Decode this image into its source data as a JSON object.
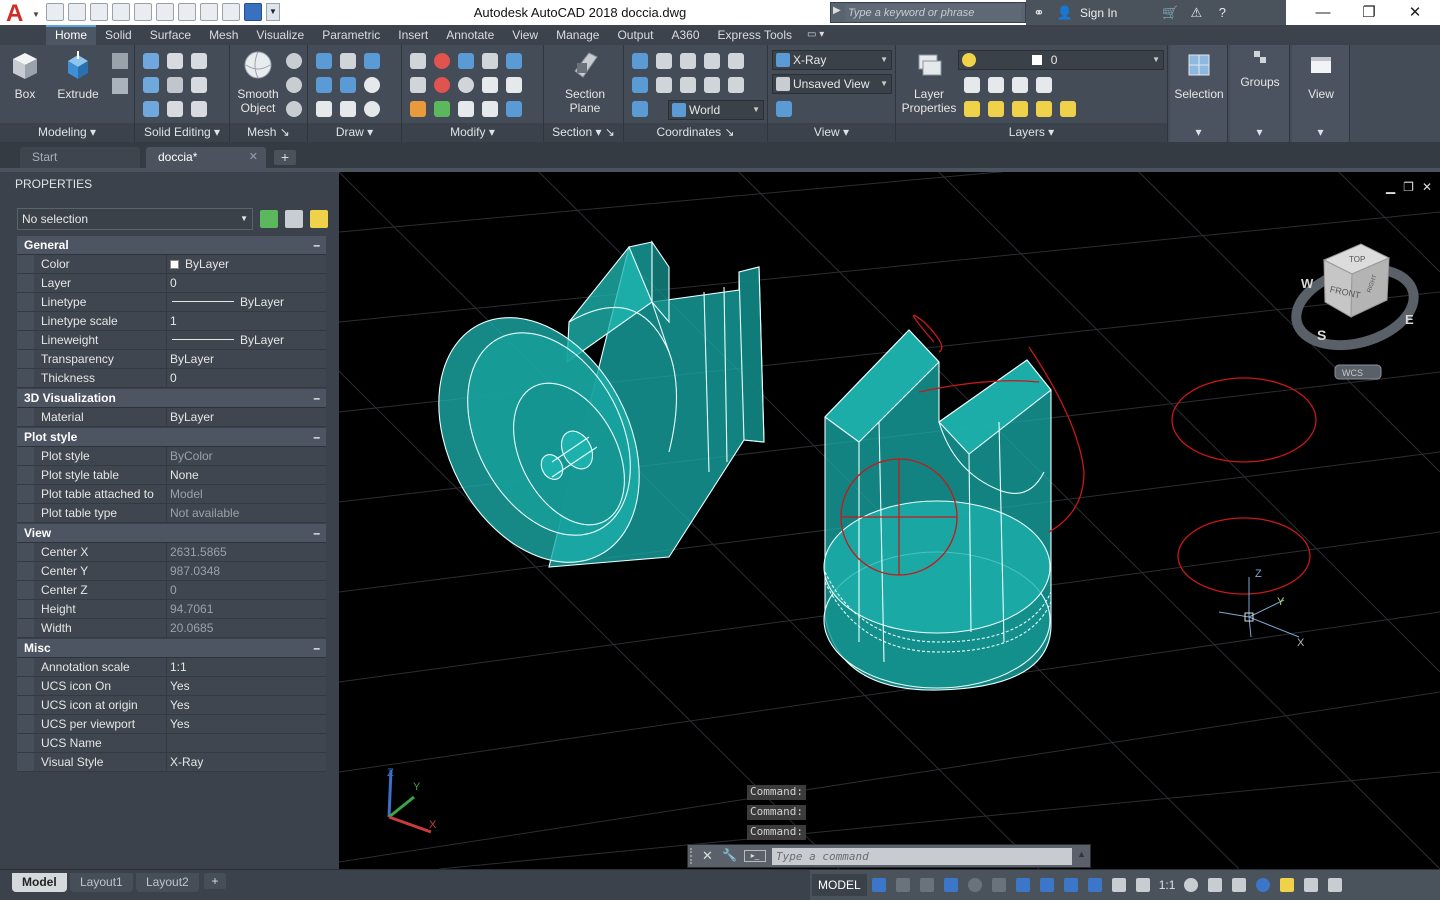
{
  "app": {
    "window_title": "Autodesk AutoCAD 2018    doccia.dwg",
    "search_placeholder": "Type a keyword or phrase",
    "sign_in": "Sign In"
  },
  "ribbon_tabs": [
    "Home",
    "Solid",
    "Surface",
    "Mesh",
    "Visualize",
    "Parametric",
    "Insert",
    "Annotate",
    "View",
    "Manage",
    "Output",
    "A360",
    "Express Tools"
  ],
  "ribbon": {
    "panels": {
      "modeling": "Modeling",
      "solid_editing": "Solid Editing",
      "mesh": "Mesh",
      "draw": "Draw",
      "modify": "Modify",
      "section": "Section",
      "coordinates": "Coordinates",
      "view": "View",
      "layers": "Layers"
    },
    "buttons": {
      "box": "Box",
      "extrude": "Extrude",
      "smooth_object": "Smooth Object",
      "section_plane": "Section Plane",
      "layer_properties": "Layer Properties",
      "selection": "Selection",
      "groups": "Groups",
      "view": "View"
    },
    "visual_style": "X-Ray",
    "named_view": "Unsaved View",
    "ucs": "World",
    "layer_current": "0"
  },
  "doc_tabs": {
    "start": "Start",
    "current": "doccia*"
  },
  "properties": {
    "title": "PROPERTIES",
    "selection": "No selection",
    "general": {
      "header": "General",
      "rows": [
        {
          "name": "Color",
          "value": "ByLayer"
        },
        {
          "name": "Layer",
          "value": "0"
        },
        {
          "name": "Linetype",
          "value": "ByLayer"
        },
        {
          "name": "Linetype scale",
          "value": "1"
        },
        {
          "name": "Lineweight",
          "value": "ByLayer"
        },
        {
          "name": "Transparency",
          "value": "ByLayer"
        },
        {
          "name": "Thickness",
          "value": "0"
        }
      ]
    },
    "viz": {
      "header": "3D Visualization",
      "rows": [
        {
          "name": "Material",
          "value": "ByLayer"
        }
      ]
    },
    "plot": {
      "header": "Plot style",
      "rows": [
        {
          "name": "Plot style",
          "value": "ByColor"
        },
        {
          "name": "Plot style table",
          "value": "None"
        },
        {
          "name": "Plot table attached to",
          "value": "Model"
        },
        {
          "name": "Plot table type",
          "value": "Not available"
        }
      ]
    },
    "view": {
      "header": "View",
      "rows": [
        {
          "name": "Center X",
          "value": "2631.5865"
        },
        {
          "name": "Center Y",
          "value": "987.0348"
        },
        {
          "name": "Center Z",
          "value": "0"
        },
        {
          "name": "Height",
          "value": "94.7061"
        },
        {
          "name": "Width",
          "value": "20.0685"
        }
      ]
    },
    "misc": {
      "header": "Misc",
      "rows": [
        {
          "name": "Annotation scale",
          "value": "1:1"
        },
        {
          "name": "UCS icon On",
          "value": "Yes"
        },
        {
          "name": "UCS icon at origin",
          "value": "Yes"
        },
        {
          "name": "UCS per viewport",
          "value": "Yes"
        },
        {
          "name": "UCS Name",
          "value": ""
        },
        {
          "name": "Visual Style",
          "value": "X-Ray"
        }
      ]
    }
  },
  "viewport": {
    "viewcube": {
      "top": "TOP",
      "front": "FRONT",
      "right": "RIGHT",
      "compass_w": "W",
      "compass_s": "S",
      "compass_e": "E",
      "wcs": "WCS"
    },
    "ucs": {
      "x": "X",
      "y": "Y",
      "z": "Z"
    },
    "command_history": [
      "Command:",
      "Command:",
      "Command:"
    ],
    "command_placeholder": "Type a command"
  },
  "status": {
    "layout_tabs": [
      "Model",
      "Layout1",
      "Layout2"
    ],
    "model_button": "MODEL",
    "scale": "1:1"
  },
  "colors": {
    "solid_fill": "#1fb8b4",
    "edge": "#e9ffff",
    "red_curve": "#c81818",
    "accent": "#59a4e0"
  }
}
